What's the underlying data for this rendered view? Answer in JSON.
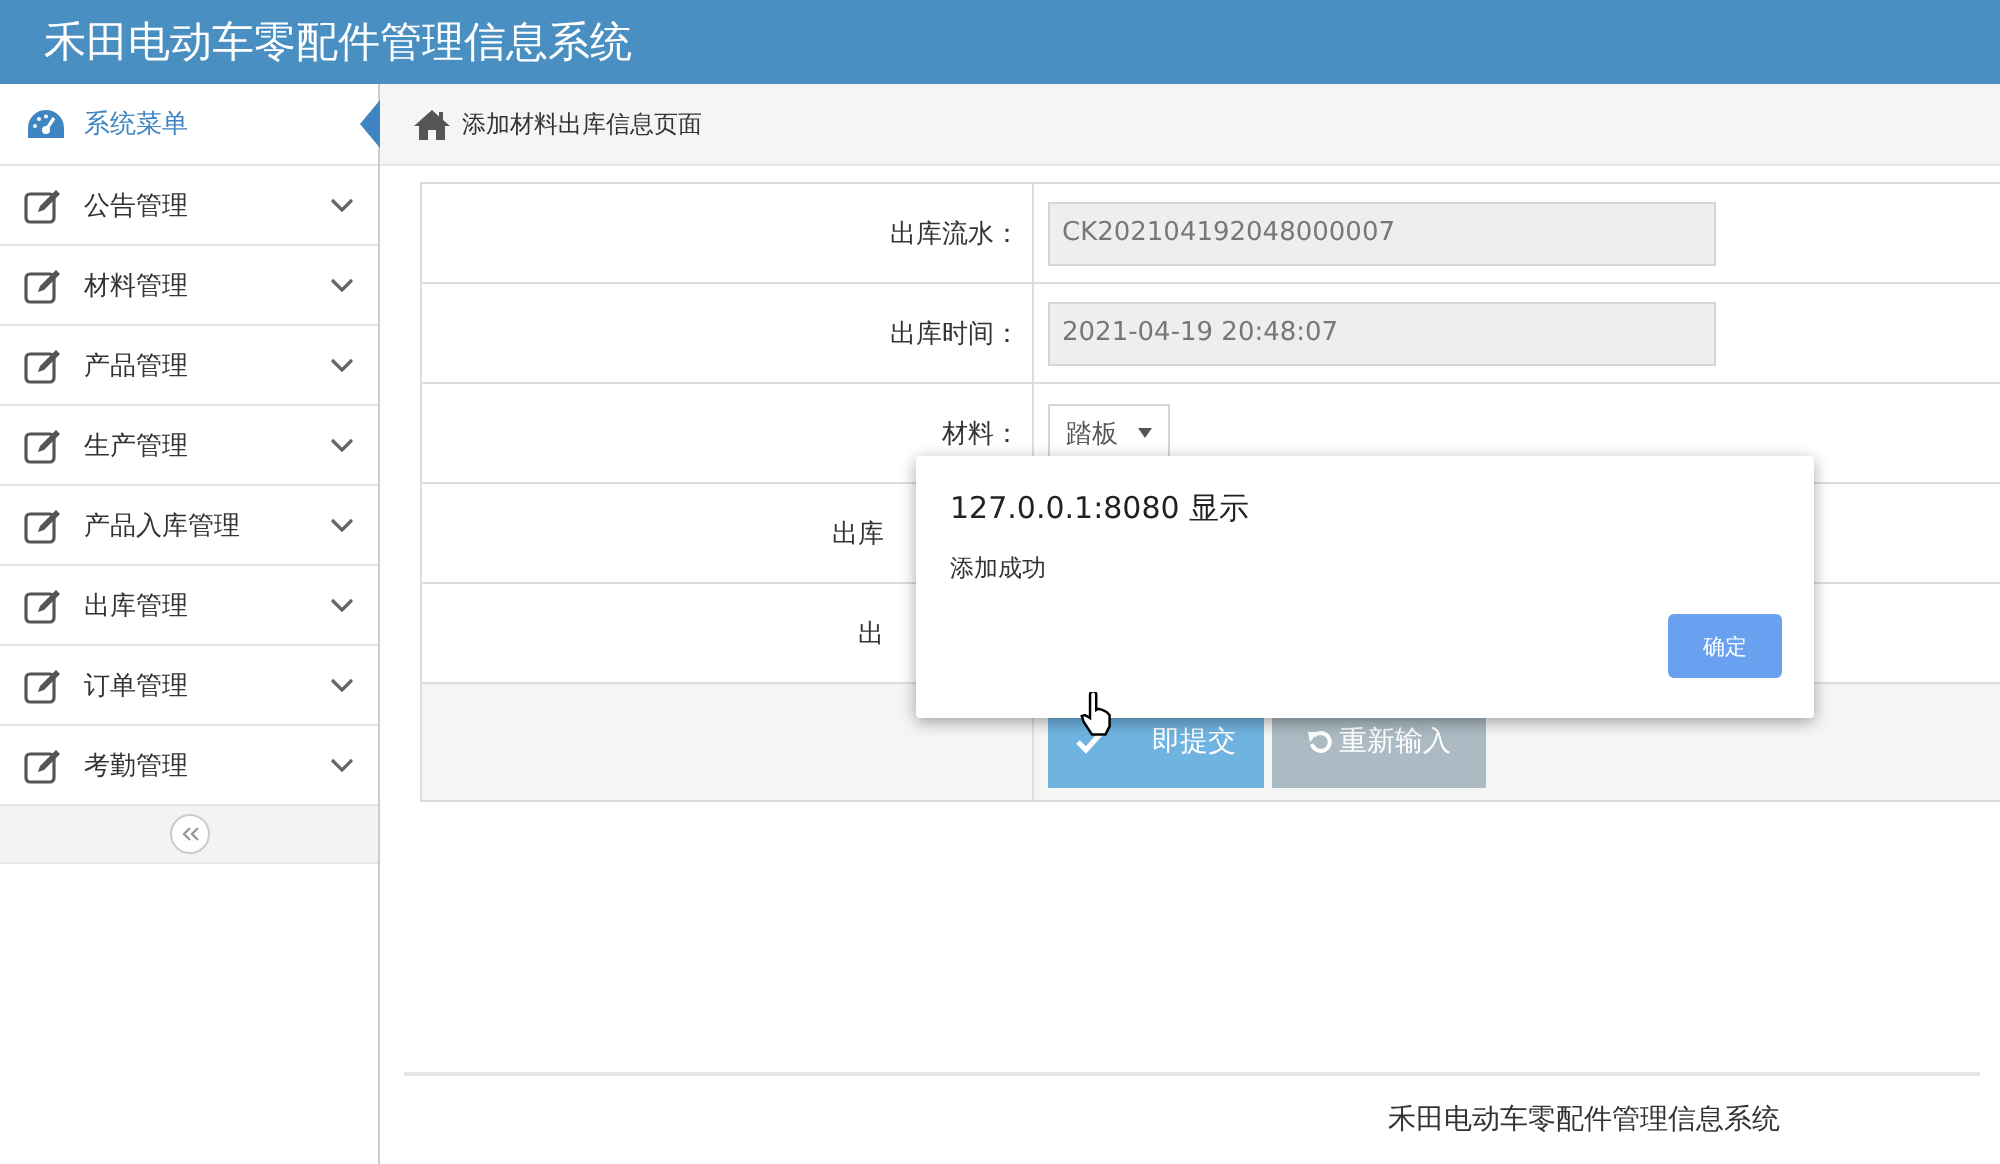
{
  "header": {
    "title": "禾田电动车零配件管理信息系统"
  },
  "sidebar": {
    "title": "系统菜单",
    "items": [
      {
        "label": "公告管理",
        "expanded": false
      },
      {
        "label": "材料管理",
        "expanded": false
      },
      {
        "label": "产品管理",
        "expanded": false
      },
      {
        "label": "生产管理",
        "expanded": false
      },
      {
        "label": "产品入库管理",
        "expanded": false
      },
      {
        "label": "出库管理",
        "expanded": false
      },
      {
        "label": "订单管理",
        "expanded": false
      },
      {
        "label": "考勤管理",
        "expanded": false
      }
    ]
  },
  "breadcrumb": "添加材料出库信息页面",
  "form": {
    "fields": [
      {
        "label": "出库流水：",
        "kind": "readonly",
        "value": "CK202104192048000007"
      },
      {
        "label": "出库时间：",
        "kind": "readonly",
        "value": "2021-04-19 20:48:07"
      },
      {
        "label": "材料：",
        "kind": "select",
        "value": "踏板"
      },
      {
        "label": "出库",
        "kind": "covered"
      },
      {
        "label": "出",
        "kind": "covered"
      }
    ],
    "buttons": [
      {
        "label": "即提交",
        "kind": "submit"
      },
      {
        "label": "重新输入",
        "kind": "reset"
      }
    ]
  },
  "dialog": {
    "title": "127.0.0.1:8080 显示",
    "message": "添加成功",
    "button": "确定"
  },
  "footer": "禾田电动车零配件管理信息系统"
}
